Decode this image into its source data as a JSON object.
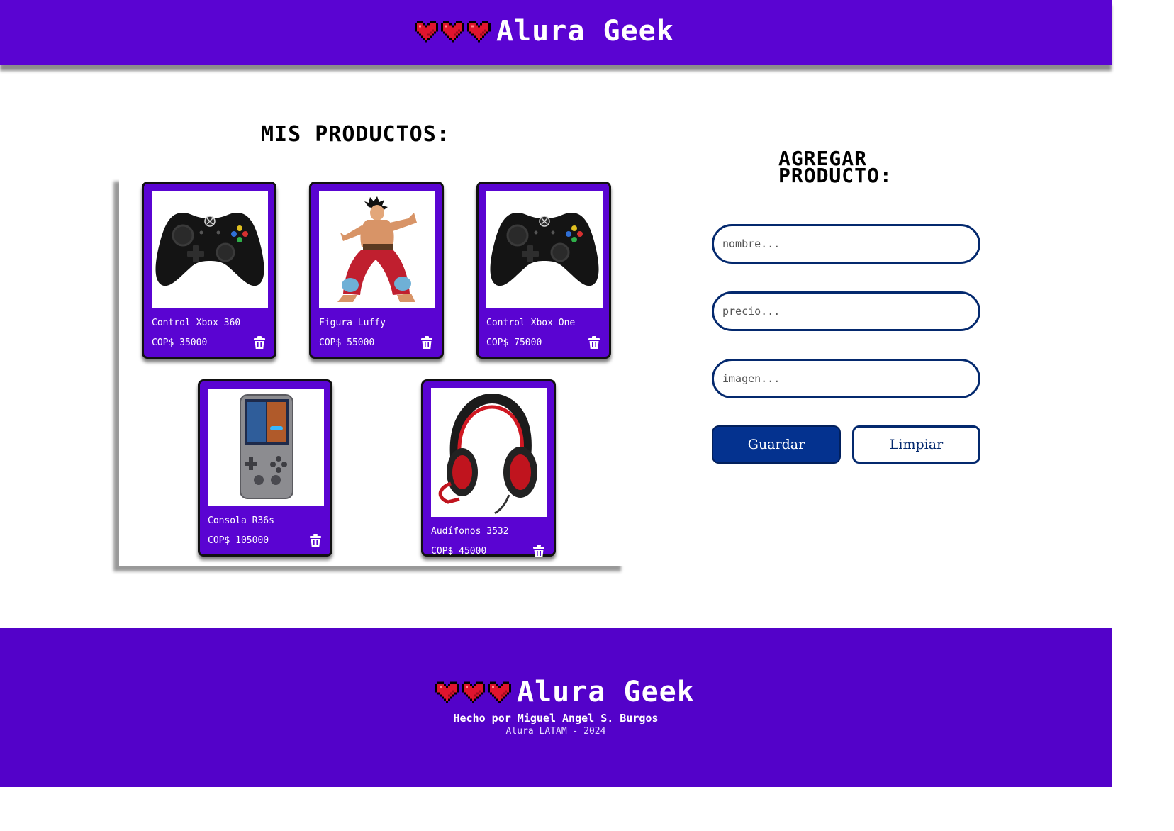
{
  "brand": {
    "name": "Alura Geek",
    "icon": "pixel-heart-icon",
    "heart_color": "#e0142e"
  },
  "colors": {
    "primary": "#5a04d2",
    "button_blue": "#04328f",
    "border_blue": "#04296e"
  },
  "products_section": {
    "title": "MIS PRODUCTOS:",
    "items": [
      {
        "name": "Control Xbox 360",
        "price": "COP$ 35000",
        "image": "xbox-controller-image"
      },
      {
        "name": "Figura Luffy",
        "price": "COP$ 55000",
        "image": "luffy-figure-image"
      },
      {
        "name": "Control Xbox One",
        "price": "COP$ 75000",
        "image": "xbox-controller-image"
      },
      {
        "name": "Consola R36s",
        "price": "COP$ 105000",
        "image": "handheld-console-image"
      },
      {
        "name": "Audífonos 3532",
        "price": "COP$ 45000",
        "image": "gaming-headset-image"
      }
    ]
  },
  "form": {
    "title_line1": "AGREGAR",
    "title_line2": "PRODUCTO:",
    "name_placeholder": "nombre...",
    "price_placeholder": "precio...",
    "image_placeholder": "imagen...",
    "save_label": "Guardar",
    "clear_label": "Limpiar"
  },
  "footer": {
    "brand": "Alura Geek",
    "author": "Hecho por Miguel Angel S. Burgos",
    "copyright": "Alura LATAM - 2024"
  }
}
